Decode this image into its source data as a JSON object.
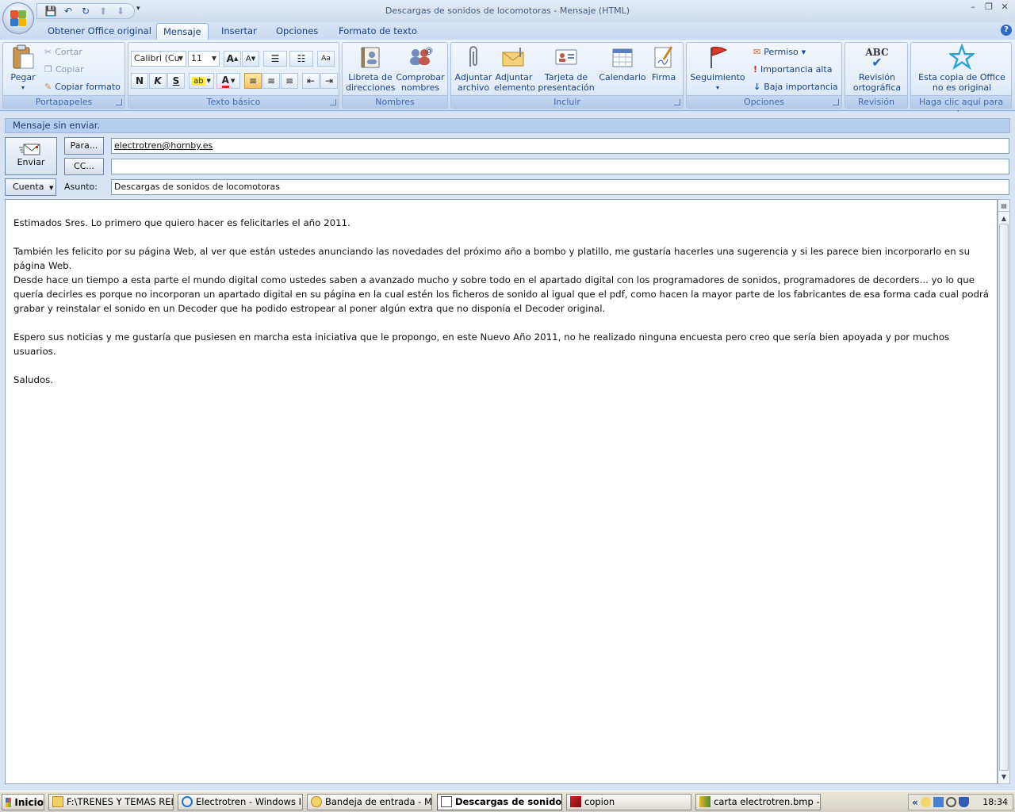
{
  "window": {
    "title": "Descargas de sonidos de locomotoras - Mensaje (HTML)"
  },
  "tabs": [
    {
      "label": "Obtener Office original"
    },
    {
      "label": "Mensaje"
    },
    {
      "label": "Insertar"
    },
    {
      "label": "Opciones"
    },
    {
      "label": "Formato de texto"
    }
  ],
  "ribbon": {
    "portapapeles": {
      "label": "Portapapeles",
      "pegar": "Pegar",
      "cortar": "Cortar",
      "copiar": "Copiar",
      "copiar_formato": "Copiar formato"
    },
    "texto_basico": {
      "label": "Texto básico",
      "font": "Calibri (Cu",
      "size": "11",
      "bold": "N",
      "italic": "K",
      "underline": "S",
      "font_color": "A"
    },
    "nombres": {
      "label": "Nombres",
      "libreta": "Libreta de direcciones",
      "comprobar": "Comprobar nombres"
    },
    "incluir": {
      "label": "Incluir",
      "adjuntar_archivo": "Adjuntar archivo",
      "adjuntar_elemento": "Adjuntar elemento",
      "tarjeta": "Tarjeta de presentación",
      "calendario": "Calendario",
      "firma": "Firma"
    },
    "opciones": {
      "label": "Opciones",
      "seguimiento": "Seguimiento",
      "permiso": "Permiso",
      "importancia_alta": "Importancia alta",
      "baja_importancia": "Baja importancia"
    },
    "revision": {
      "label": "Revisión",
      "revision_ortografica": "Revisión ortográfica",
      "abc": "ABC"
    },
    "office": {
      "label": "Haga clic aquí para ob...",
      "copia": "Esta copia de Office no es original"
    }
  },
  "message": {
    "status": "Mensaje sin enviar.",
    "send_label": "Enviar",
    "to_button": "Para...",
    "cc_button": "CC...",
    "account_button": "Cuenta",
    "subject_label": "Asunto:",
    "to": "electrotren@hornby.es",
    "cc": "",
    "subject": "Descargas de sonidos de locomotoras",
    "body": [
      "Estimados Sres. Lo primero que quiero hacer es felicitarles el año 2011.",
      "",
      "También les felicito por su página Web, al ver que están ustedes anunciando las novedades del próximo año a bombo y platillo, me gustaría hacerles una sugerencia y si les parece bien incorporarlo en su página Web.",
      "Desde hace un tiempo a esta parte el mundo digital como ustedes saben a avanzado mucho y sobre todo en el apartado digital con los programadores de sonidos, programadores de decorders... yo lo que quería decirles es porque no incorporan un apartado digital en su página en la cual estén los ficheros de sonido al igual que el pdf, como hacen la mayor parte de los fabricantes de esa forma cada cual podrá grabar y reinstalar el sonido en un Decoder que ha podido estropear al poner algún extra que no disponía el Decoder original.",
      "",
      "Espero sus noticias y me gustaría que pusiesen en marcha esta iniciativa que le propongo, en este Nuevo Año 2011,  no he realizado ninguna encuesta pero creo que sería bien apoyada y por muchos usuarios.",
      "",
      "Saludos."
    ]
  },
  "taskbar": {
    "start": "Inicio",
    "tasks": [
      {
        "label": "F:\\TRENES Y TEMAS REL..."
      },
      {
        "label": "Electrotren - Windows In..."
      },
      {
        "label": "Bandeja de entrada - Mic..."
      },
      {
        "label": "Descargas de sonidos..."
      },
      {
        "label": "copion"
      },
      {
        "label": "carta electrotren.bmp - ..."
      }
    ],
    "tray_chevron": "«",
    "clock": "18:34"
  },
  "colors": {
    "accent": "#15428b",
    "ribbon_bg": "#dbe7f6",
    "taskbar": "#ece9d8"
  }
}
